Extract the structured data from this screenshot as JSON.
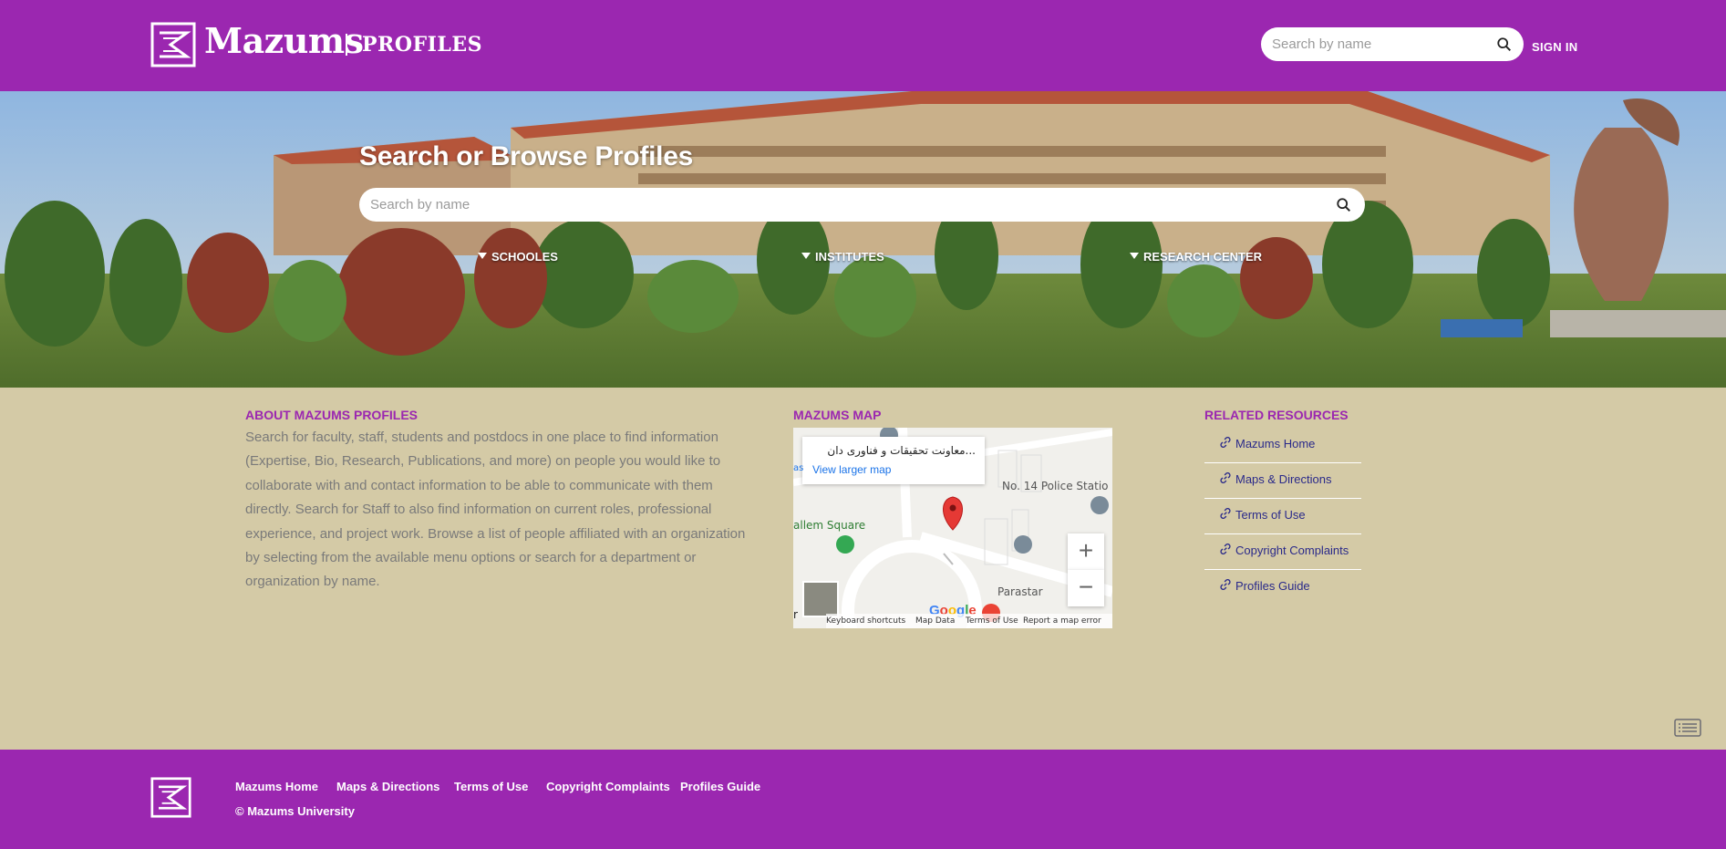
{
  "header": {
    "brand": "Mazums",
    "brand_sub": "PROFILES",
    "search_placeholder": "Search by name",
    "sign_in": "SIGN IN"
  },
  "hero": {
    "title": "Search or Browse Profiles",
    "search_placeholder": "Search by name",
    "nav": [
      {
        "label": "SCHOOLES"
      },
      {
        "label": "INSTITUTES"
      },
      {
        "label": "RESEARCH CENTER"
      }
    ]
  },
  "about": {
    "title": "ABOUT MAZUMS PROFILES",
    "text": "Search for faculty, staff, students and postdocs in one place to find information (Expertise, Bio, Research, Publications, and more) on people you would like to collaborate with and contact information to be able to communicate with them directly. Search for Staff to also find information on current roles, professional experience, and project work. Browse a list of people affiliated with an organization by selecting from the available menu options or search for a department or organization by name."
  },
  "map": {
    "title": "MAZUMS MAP",
    "card_title": "معاونت تحقیقات و فناوری دان...",
    "card_link": "View larger map",
    "labels": {
      "police": "No. 14 Police Statio",
      "square": "allem Square",
      "street": "Parastar",
      "partial_left": "as",
      "partial_r": "r"
    },
    "google": "Google",
    "zoom_in": "+",
    "zoom_out": "−",
    "footer": {
      "shortcuts": "Keyboard shortcuts",
      "map_data": "Map Data",
      "terms": "Terms of Use",
      "report": "Report a map error"
    }
  },
  "resources": {
    "title": "RELATED RESOURCES",
    "items": [
      {
        "label": "Mazums Home"
      },
      {
        "label": "Maps & Directions"
      },
      {
        "label": "Terms of Use"
      },
      {
        "label": "Copyright Complaints"
      },
      {
        "label": "Profiles Guide"
      }
    ]
  },
  "footer": {
    "links": [
      {
        "label": "Mazums Home"
      },
      {
        "label": "Maps & Directions"
      },
      {
        "label": "Terms of Use"
      },
      {
        "label": "Copyright Complaints"
      },
      {
        "label": "Profiles Guide"
      }
    ],
    "copyright": "© Mazums University"
  },
  "colors": {
    "primary": "#9b27b0",
    "background": "#d4caa6",
    "link": "#2a2a8a",
    "map_link": "#1a73e8"
  }
}
